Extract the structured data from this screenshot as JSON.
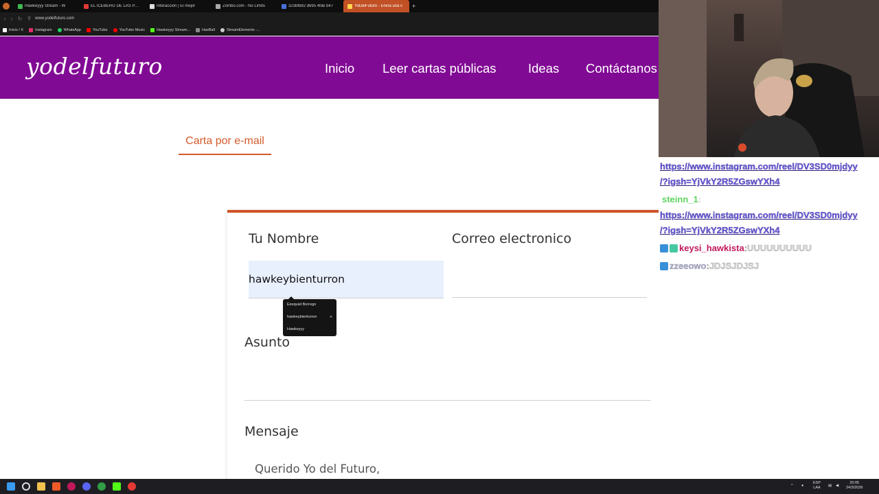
{
  "browser": {
    "tabs": [
      {
        "label": "Hawkeyyy Stream - W",
        "color": "#3fb950"
      },
      {
        "label": "EL ICEBERG DE LAS PÁGI",
        "color": "#e53935"
      },
      {
        "label": "Interacción | El mejor",
        "color": "#dddddd"
      },
      {
        "label": "Zombo.com - No Limits",
        "color": "#aaaaaa"
      },
      {
        "label": "323bfb82 d695 4fde b47",
        "color": "#4a6fd6"
      },
      {
        "label": "YoDelFuturo - Envía una c",
        "color": "#ffd54f",
        "active": true
      }
    ],
    "new_tab": "+",
    "url": "www.yodelfuturo.com",
    "bookmarks": [
      {
        "label": "Inicio / X",
        "color": "#ffffff"
      },
      {
        "label": "Instagram",
        "color": "#e1306c"
      },
      {
        "label": "WhatsApp",
        "color": "#25d366"
      },
      {
        "label": "YouTube",
        "color": "#ff0000"
      },
      {
        "label": "YouTube Music",
        "color": "#ff0000"
      },
      {
        "label": "Hawkeyyy Stream...",
        "color": "#53fc18"
      },
      {
        "label": "HaxBall",
        "color": "#888888"
      },
      {
        "label": "StreamElements -...",
        "color": "#cccccc"
      }
    ]
  },
  "site": {
    "logo": "yodelfuturo",
    "nav": [
      "Inicio",
      "Leer cartas públicas",
      "Ideas",
      "Contáctanos"
    ],
    "tab_label": "Carta por e-mail",
    "form": {
      "name_label": "Tu Nombre",
      "name_value": "hawkeybienturron",
      "email_label": "Correo electronico",
      "subject_label": "Asunto",
      "message_label": "Mensaje",
      "message_text": "Querido Yo del Futuro,"
    },
    "autofill": [
      "Ezequiel Borrego",
      "hawkeybienturron",
      "Hawkeyyy"
    ],
    "autofill_close": "×"
  },
  "chat": {
    "messages": [
      {
        "type": "link",
        "text": "https://www.instagram.com/reel/DV3SD0mjdyy"
      },
      {
        "type": "link",
        "text": "/?igsh=YjVkY2R5ZGswYXh4"
      },
      {
        "type": "user",
        "user": "steinn_1",
        "sep": " :",
        "text": "",
        "color": "#5fd35f"
      },
      {
        "type": "link",
        "text": "https://www.instagram.com/reel/DV3SD0mjdyy"
      },
      {
        "type": "link",
        "text": "/?igsh=YjVkY2R5ZGswYXh4"
      },
      {
        "type": "user",
        "user": "keysi_hawkista",
        "sep": " : ",
        "text": "UUUUUUUUUU",
        "color": "#c2185b"
      },
      {
        "type": "user",
        "user": "zzeeowo",
        "sep": " : ",
        "text": "JDJSJDJSJ",
        "color": "#b0b0d8"
      }
    ]
  },
  "taskbar": {
    "lang": "ESP",
    "layout": "LAA",
    "time": "20:05",
    "date": "24/3/2026"
  }
}
